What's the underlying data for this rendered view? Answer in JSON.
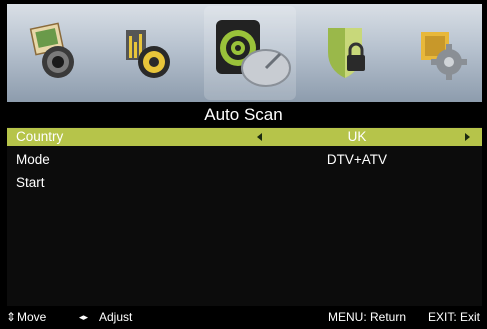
{
  "menu_icons": [
    {
      "name": "picture-icon"
    },
    {
      "name": "sound-icon"
    },
    {
      "name": "channel-icon"
    },
    {
      "name": "lock-icon"
    },
    {
      "name": "setup-icon"
    }
  ],
  "title": "Auto Scan",
  "rows": [
    {
      "label": "Country",
      "value": "UK"
    },
    {
      "label": "Mode",
      "value": "DTV+ATV"
    },
    {
      "label": "Start",
      "value": ""
    }
  ],
  "footer": {
    "move_icon": "⇕",
    "move": "Move",
    "adjust_icon": "◂▸",
    "adjust": "Adjust",
    "menu_return": "MENU: Return",
    "exit": "EXIT: Exit"
  },
  "colors": {
    "highlight": "#b6c44a",
    "background": "#000000"
  }
}
